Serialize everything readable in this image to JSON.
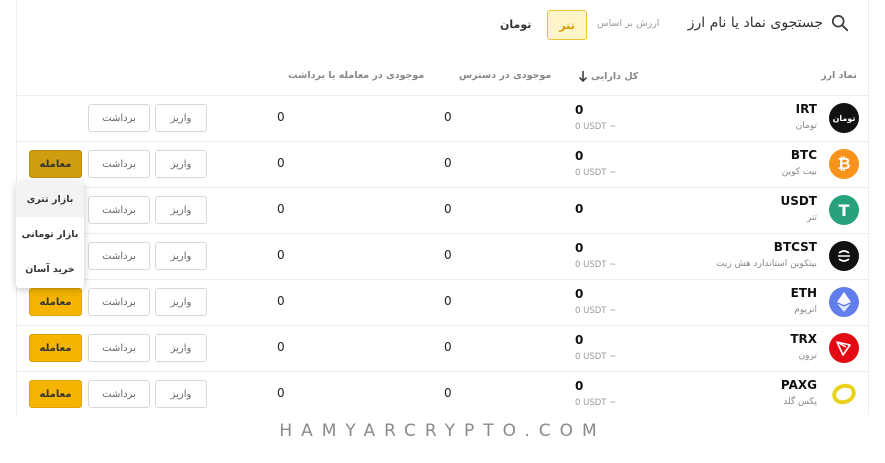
{
  "search": {
    "label": "جستجوی نماد یا نام ارز"
  },
  "base_toggle": {
    "label": "ارزش بر اساس",
    "options": [
      "تتر",
      "تومان"
    ],
    "selected": "تتر"
  },
  "columns": {
    "symbol": "نماد ارز",
    "total": "کل دارایی",
    "available": "موجودی در دسترس",
    "in_trade": "موجودی در معامله یا برداشت"
  },
  "buttons": {
    "deposit": "واریز",
    "withdraw": "برداشت",
    "trade": "معامله"
  },
  "rows": [
    {
      "symbol": "IRT",
      "name": "تومان",
      "total": "0",
      "total_usdt": "0 USDT ~",
      "available": "0",
      "in_trade": "0",
      "has_trade": false,
      "icon": "toman-icon",
      "icon_text": "تومان",
      "color": "#111111"
    },
    {
      "symbol": "BTC",
      "name": "بیت کوین",
      "total": "0",
      "total_usdt": "0 USDT ~",
      "available": "0",
      "in_trade": "0",
      "has_trade": true,
      "icon": "bitcoin-icon",
      "icon_text": "₿",
      "color": "#f7931a"
    },
    {
      "symbol": "USDT",
      "name": "تتر",
      "total": "0",
      "total_usdt": "",
      "available": "0",
      "in_trade": "0",
      "has_trade": false,
      "icon": "tether-icon",
      "icon_text": "T",
      "color": "#26a17b"
    },
    {
      "symbol": "BTCST",
      "name": "بیتکوین استاندارد هش ریت",
      "total": "0",
      "total_usdt": "0 USDT ~",
      "available": "0",
      "in_trade": "0",
      "has_trade": false,
      "icon": "btcst-icon",
      "icon_text": "",
      "color": "#111111"
    },
    {
      "symbol": "ETH",
      "name": "اتریوم",
      "total": "0",
      "total_usdt": "0 USDT ~",
      "available": "0",
      "in_trade": "0",
      "has_trade": true,
      "icon": "ethereum-icon",
      "icon_text": "",
      "color": "#627eea"
    },
    {
      "symbol": "TRX",
      "name": "ترون",
      "total": "0",
      "total_usdt": "0 USDT ~",
      "available": "0",
      "in_trade": "0",
      "has_trade": true,
      "icon": "tron-icon",
      "icon_text": "",
      "color": "#e50914"
    },
    {
      "symbol": "PAXG",
      "name": "پکس گلد",
      "total": "0",
      "total_usdt": "0 USDT ~",
      "available": "0",
      "in_trade": "0",
      "has_trade": true,
      "icon": "pax-gold-icon",
      "icon_text": "",
      "color": "#e9d21c"
    }
  ],
  "trade_menu": {
    "items": [
      "بازار تتری",
      "بازار تومانی",
      "خرید آسان"
    ]
  },
  "watermark": "HAMYARCRYPTO.COM"
}
